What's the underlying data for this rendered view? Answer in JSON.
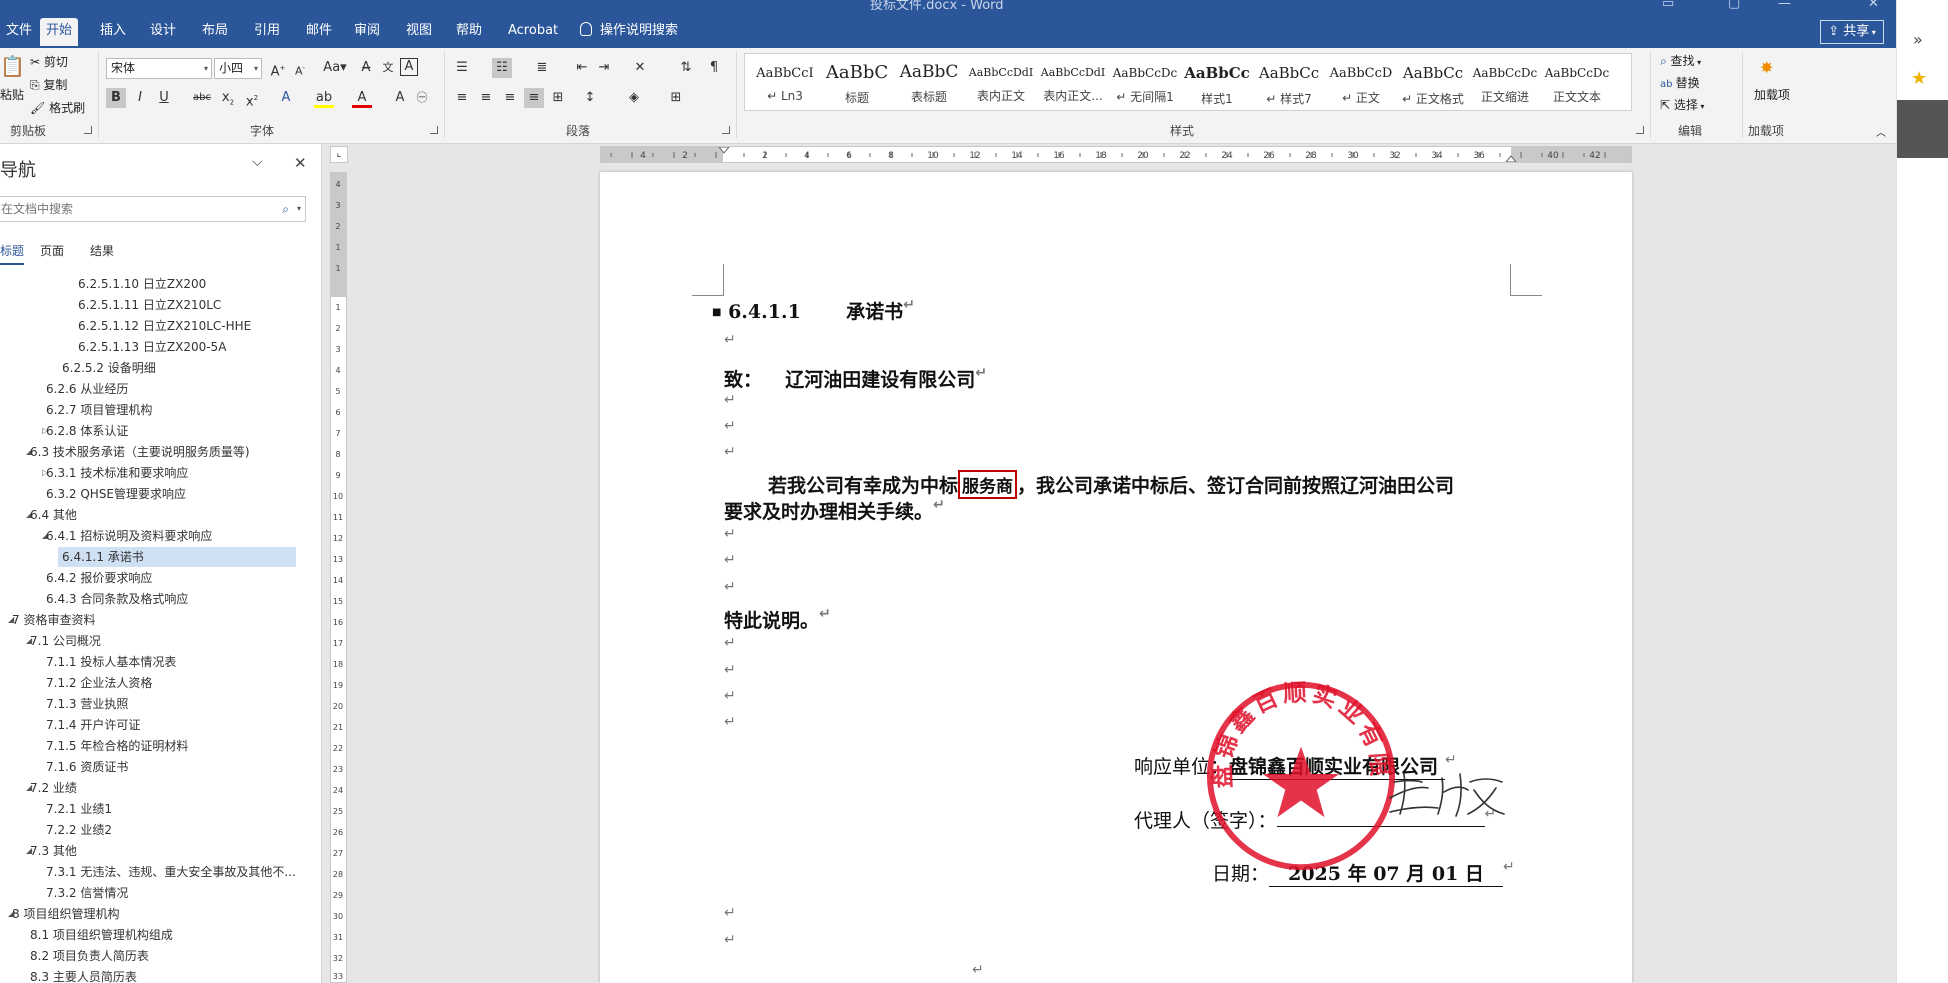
{
  "window": {
    "title": "投标文件.docx - Word"
  },
  "tabs": [
    "文件",
    "开始",
    "插入",
    "设计",
    "布局",
    "引用",
    "邮件",
    "审阅",
    "视图",
    "帮助",
    "Acrobat"
  ],
  "active_tab": "开始",
  "tell_me": "操作说明搜索",
  "share_label": "共享",
  "clipboard": {
    "paste": "粘贴",
    "cut": "剪切",
    "copy": "复制",
    "format_painter": "格式刷",
    "group": "剪贴板"
  },
  "font": {
    "name": "宋体",
    "size": "小四",
    "group": "字体"
  },
  "paragraph": {
    "group": "段落"
  },
  "styles": {
    "group": "样式",
    "items": [
      {
        "sample": "AaBbCcI",
        "name": "↵ Ln3"
      },
      {
        "sample": "AaBbC",
        "name": "标题"
      },
      {
        "sample": "AaBbC",
        "name": "表标题"
      },
      {
        "sample": "AaBbCcDdI",
        "name": "表内正文"
      },
      {
        "sample": "AaBbCcDdI",
        "name": "表内正文..."
      },
      {
        "sample": "AaBbCcDc",
        "name": "↵ 无间隔1"
      },
      {
        "sample": "AaBbCc",
        "name": "样式1"
      },
      {
        "sample": "AaBbCc",
        "name": "↵ 样式7"
      },
      {
        "sample": "AaBbCcD",
        "name": "↵ 正文"
      },
      {
        "sample": "AaBbCc",
        "name": "↵ 正文格式"
      },
      {
        "sample": "AaBbCcDc",
        "name": "正文缩进"
      },
      {
        "sample": "AaBbCcDc",
        "name": "正文文本"
      }
    ]
  },
  "editing": {
    "find": "查找",
    "replace": "替换",
    "select": "选择",
    "group": "编辑"
  },
  "addins": {
    "label": "加载项",
    "group": "加载项"
  },
  "nav": {
    "title": "导航",
    "search_placeholder": "在文档中搜索",
    "tabs": [
      "标题",
      "页面",
      "结果"
    ],
    "items": [
      {
        "text": "6.2.5.1.10 日立ZX200",
        "level": 4
      },
      {
        "text": "6.2.5.1.11 日立ZX210LC",
        "level": 4
      },
      {
        "text": "6.2.5.1.12 日立ZX210LC-HHE",
        "level": 4
      },
      {
        "text": "6.2.5.1.13 日立ZX200-5A",
        "level": 4
      },
      {
        "text": "6.2.5.2 设备明细",
        "level": 3
      },
      {
        "text": "6.2.6 从业经历",
        "level": 2
      },
      {
        "text": "6.2.7 项目管理机构",
        "level": 2
      },
      {
        "text": "6.2.8 体系认证",
        "level": 2,
        "expander": "collapsed"
      },
      {
        "text": "6.3 技术服务承诺（主要说明服务质量等)",
        "level": 1,
        "expander": "expanded"
      },
      {
        "text": "6.3.1 技术标准和要求响应",
        "level": 2,
        "expander": "collapsed"
      },
      {
        "text": "6.3.2 QHSE管理要求响应",
        "level": 2
      },
      {
        "text": "6.4 其他",
        "level": 1,
        "expander": "expanded"
      },
      {
        "text": "6.4.1 招标说明及资料要求响应",
        "level": 2,
        "expander": "expanded"
      },
      {
        "text": "6.4.1.1 承诺书",
        "level": 3,
        "selected": true
      },
      {
        "text": "6.4.2 报价要求响应",
        "level": 2
      },
      {
        "text": "6.4.3 合同条款及格式响应",
        "level": 2
      },
      {
        "text": "7 资格审查资料",
        "level": 0,
        "expander": "expanded"
      },
      {
        "text": "7.1 公司概况",
        "level": 1,
        "expander": "expanded"
      },
      {
        "text": "7.1.1 投标人基本情况表",
        "level": 2
      },
      {
        "text": "7.1.2 企业法人资格",
        "level": 2
      },
      {
        "text": "7.1.3 营业执照",
        "level": 2
      },
      {
        "text": "7.1.4 开户许可证",
        "level": 2
      },
      {
        "text": "7.1.5 年检合格的证明材料",
        "level": 2
      },
      {
        "text": "7.1.6 资质证书",
        "level": 2
      },
      {
        "text": "7.2 业绩",
        "level": 1,
        "expander": "expanded"
      },
      {
        "text": "7.2.1 业绩1",
        "level": 2
      },
      {
        "text": "7.2.2 业绩2",
        "level": 2
      },
      {
        "text": "7.3 其他",
        "level": 1,
        "expander": "expanded"
      },
      {
        "text": "7.3.1 无违法、违规、重大安全事故及其他不...",
        "level": 2
      },
      {
        "text": "7.3.2 信誉情况",
        "level": 2
      },
      {
        "text": "8 项目组织管理机构",
        "level": 0,
        "expander": "expanded"
      },
      {
        "text": "8.1 项目组织管理机构组成",
        "level": 1
      },
      {
        "text": "8.2 项目负责人简历表",
        "level": 1
      },
      {
        "text": "8.3 主要人员简历表",
        "level": 1
      }
    ]
  },
  "document": {
    "heading_number": "6.4.1.1",
    "heading_title": "承诺书",
    "to_label": "致：",
    "to_company": "辽河油田建设有限公司",
    "body_before": "若我公司有幸成为中标",
    "body_highlight": "服务商",
    "body_after": "，我公司承诺中标后、签订合同前按照辽河油田公司",
    "body_line2": "要求及时办理相关手续。",
    "special_note": "特此说明。",
    "respondent_label": "响应单位：",
    "respondent_value": "盘锦鑫百顺实业有限公司",
    "agent_label": "代理人（签字）：",
    "date_label": "日期：",
    "date_value": "2025 年 07 月 01 日",
    "seal_text": "盘锦鑫百顺实业有限公司",
    "signature_text": "王秋霞"
  },
  "colors": {
    "ribbon_blue": "#2b579a",
    "seal_red": "#e0102a",
    "highlight_box": "#c00000"
  }
}
